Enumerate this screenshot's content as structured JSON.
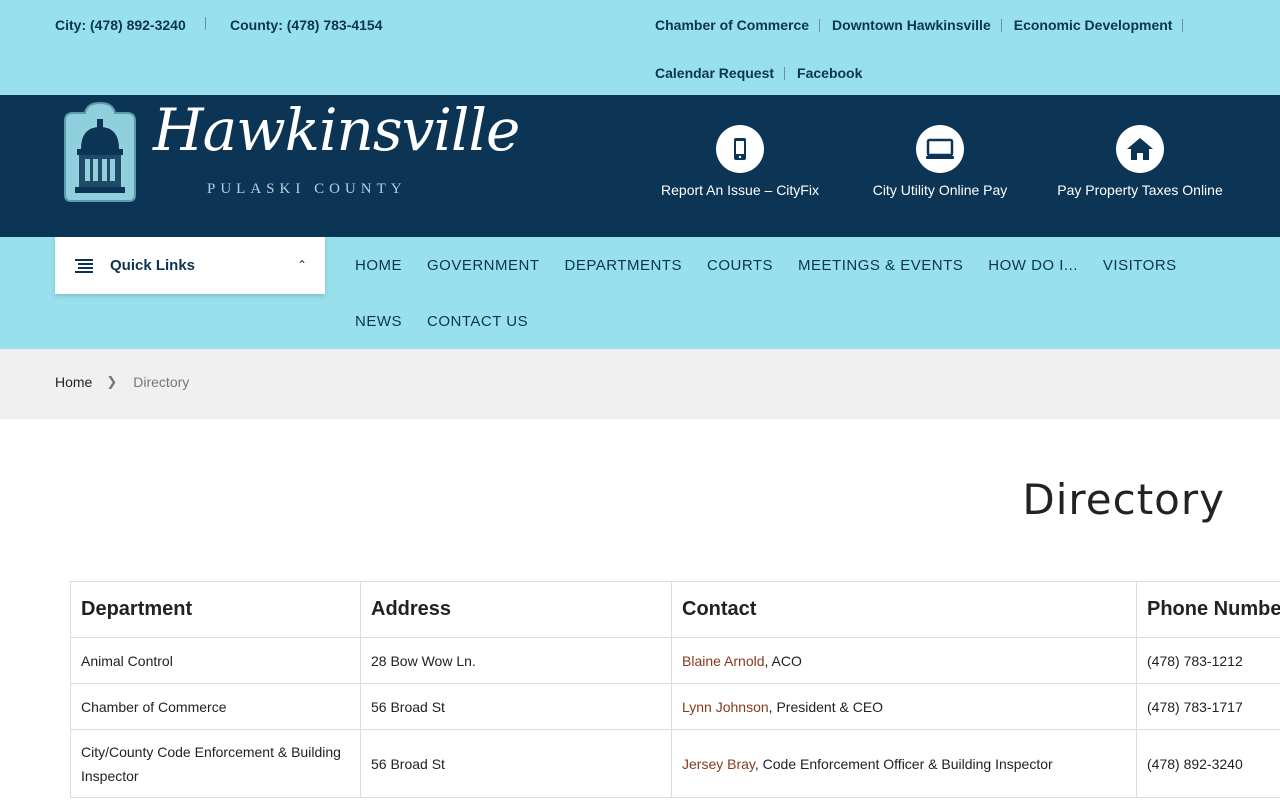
{
  "topbar": {
    "city_phone": "City: (478) 892-3240",
    "county_phone": "County: (478) 783-4154",
    "links": [
      "Chamber of Commerce",
      "Downtown Hawkinsville",
      "Economic Development",
      "Calendar Request",
      "Facebook"
    ]
  },
  "header": {
    "logo_script": "Hawkinsville",
    "logo_subtitle": "PULASKI COUNTY",
    "quick_actions": [
      {
        "label": "Report An Issue – CityFix",
        "icon": "smartphone-icon"
      },
      {
        "label": "City Utility Online Pay",
        "icon": "monitor-icon"
      },
      {
        "label": "Pay Property Taxes Online",
        "icon": "home-icon"
      }
    ]
  },
  "nav": {
    "quick_links_label": "Quick Links",
    "items": [
      "HOME",
      "GOVERNMENT",
      "DEPARTMENTS",
      "COURTS",
      "MEETINGS & EVENTS",
      "HOW DO I...",
      "VISITORS",
      "NEWS",
      "CONTACT US"
    ]
  },
  "breadcrumb": {
    "home": "Home",
    "current": "Directory"
  },
  "page": {
    "title": "Directory"
  },
  "directory": {
    "headers": [
      "Department",
      "Address",
      "Contact",
      "Phone Number"
    ],
    "rows": [
      {
        "department": "Animal Control",
        "address": "28 Bow Wow Ln.",
        "contact_name": "Blaine Arnold",
        "contact_role": ", ACO",
        "phone": "(478) 783-1212"
      },
      {
        "department": "Chamber of Commerce",
        "address": "56 Broad St",
        "contact_name": "Lynn Johnson",
        "contact_role": ", President & CEO",
        "phone": "(478) 783-1717"
      },
      {
        "department": "City/County Code Enforcement & Building Inspector",
        "address": "56 Broad St",
        "contact_name": "Jersey Bray",
        "contact_role": ", Code Enforcement Officer & Building Inspector",
        "phone": "(478) 892-3240"
      }
    ]
  },
  "colors": {
    "light_blue": "#97e0ec",
    "navy": "#0c3454",
    "link_brown": "#8a3a1c",
    "crumb_bg": "#f0f0f0"
  }
}
